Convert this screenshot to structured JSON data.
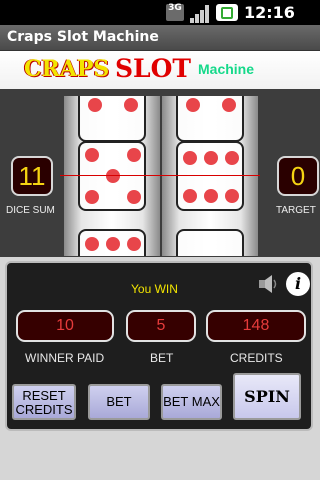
{
  "status_bar": {
    "network": "3G",
    "time": "12:16 PM"
  },
  "app": {
    "title": "Craps Slot Machine"
  },
  "banner": {
    "word1": "CRAPS",
    "word2": "SLOT",
    "word3": "Machine"
  },
  "reels": {
    "dice_sum": "11",
    "dice_sum_label": "DICE SUM",
    "target": "0",
    "target_label": "TARGET"
  },
  "panel": {
    "message": "You WIN",
    "winner_paid": "10",
    "winner_paid_label": "WINNER PAID",
    "bet": "5",
    "bet_label": "BET",
    "credits": "148",
    "credits_label": "CREDITS"
  },
  "buttons": {
    "reset_line1": "RESET",
    "reset_line2": "CREDITS",
    "bet": "BET",
    "bet_max": "BET MAX",
    "spin": "SPIN"
  },
  "colors": {
    "accent_yellow": "#f2e400",
    "accent_red": "#e00000",
    "machine_green": "#15d98a"
  }
}
